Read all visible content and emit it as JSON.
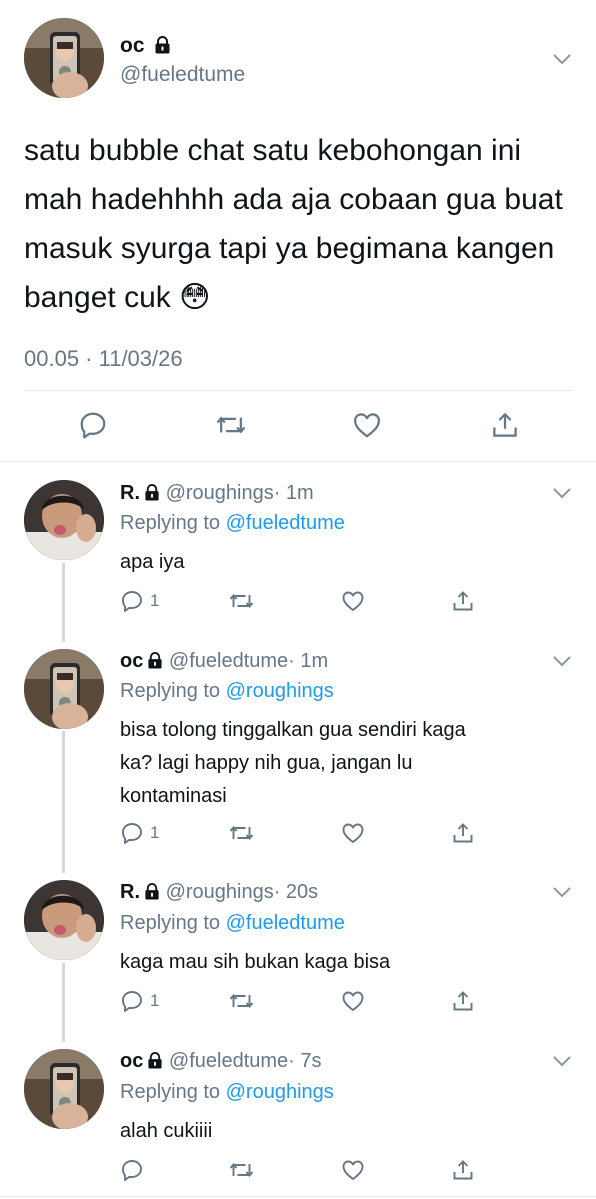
{
  "main_tweet": {
    "display_name": "oc",
    "handle": "@fueledtume",
    "text": "satu bubble chat satu kebohongan ini mah hadehhhh ada aja cobaan gua buat masuk syurga tapi ya begimana kangen banget cuk",
    "emoji": "😳",
    "timestamp": "00.05 · 11/03/26"
  },
  "replies": [
    {
      "display_name": "R.",
      "handle": "@roughings",
      "time": "· 1m",
      "replying_label": "Replying to",
      "replying_to": "@fueledtume",
      "lines": [
        "apa iya"
      ],
      "reply_count": "1"
    },
    {
      "display_name": "oc",
      "handle": "@fueledtume",
      "time": "· 1m",
      "replying_label": "Replying to",
      "replying_to": "@roughings",
      "lines": [
        "bisa tolong tinggalkan gua sendiri kaga",
        "ka? lagi happy nih gua, jangan lu",
        "kontaminasi"
      ],
      "reply_count": "1"
    },
    {
      "display_name": "R.",
      "handle": "@roughings",
      "time": "· 20s",
      "replying_label": "Replying to",
      "replying_to": "@fueledtume",
      "lines": [
        "kaga mau sih bukan kaga bisa"
      ],
      "reply_count": "1"
    },
    {
      "display_name": "oc",
      "handle": "@fueledtume",
      "time": "· 7s",
      "replying_label": "Replying to",
      "replying_to": "@roughings",
      "lines": [
        "alah cukiiii"
      ],
      "reply_count": ""
    }
  ],
  "icons": {
    "lock": "lock-icon",
    "chevron": "chevron-down-icon",
    "reply": "reply-icon",
    "retweet": "retweet-icon",
    "like": "heart-icon",
    "share": "share-icon"
  },
  "colors": {
    "link": "#1d9bf0",
    "secondary": "#657786",
    "divider": "#e6ecf0",
    "thread_line": "#cfd9de"
  }
}
